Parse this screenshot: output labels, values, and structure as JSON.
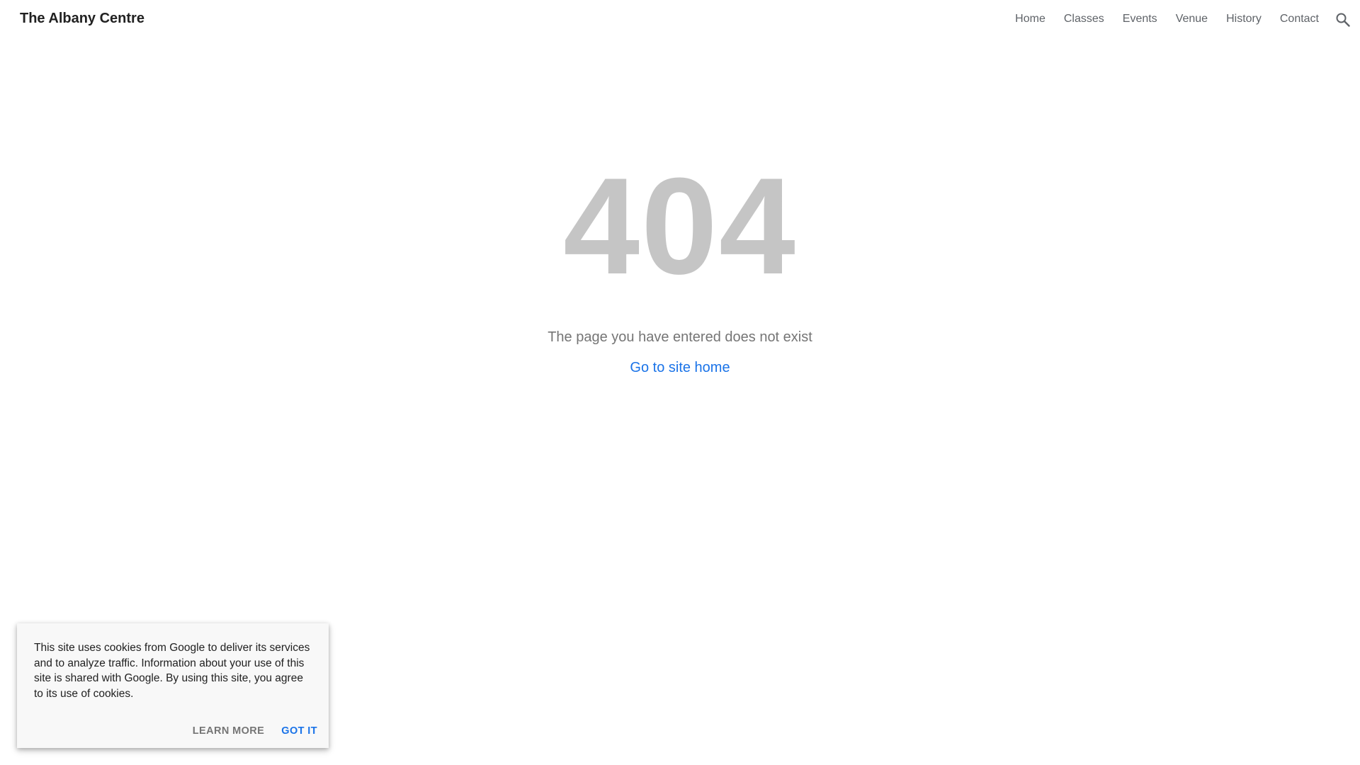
{
  "header": {
    "site_title": "The Albany Centre",
    "nav": [
      "Home",
      "Classes",
      "Events",
      "Venue",
      "History",
      "Contact"
    ],
    "search_icon": "search-icon"
  },
  "main": {
    "code": "404",
    "message": "The page you have entered does not exist",
    "link": "Go to site home"
  },
  "cookie": {
    "text": "This site uses cookies from Google to deliver its services and to analyze traffic. Information about your use of this site is shared with Google. By using this site, you agree to its use of cookies.",
    "learn_more": "LEARN MORE",
    "got_it": "GOT IT"
  },
  "colors": {
    "code": "#c5c5c5",
    "link": "#1a73e8",
    "nav": "#5f6368",
    "message": "#757575"
  }
}
